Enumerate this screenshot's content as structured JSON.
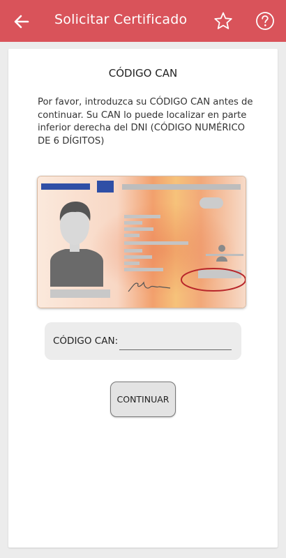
{
  "appbar": {
    "title": "Solicitar Certificado",
    "icons": [
      "arrow-left-icon",
      "star-icon",
      "help-icon"
    ]
  },
  "card": {
    "heading": "CÓDIGO CAN",
    "instructions": "Por favor, introduzca su CÓDIGO CAN antes de continuar. Su CAN lo puede localizar en parte inferior derecha del DNI (CÓDIGO NUMÉRICO DE 6 DÍGITOS)"
  },
  "form": {
    "can_label": "CÓDIGO CAN:",
    "can_value": ""
  },
  "actions": {
    "continue_label": "CONTINUAR"
  },
  "colors": {
    "appbar": "#d9535a",
    "card": "#ffffff",
    "background": "#ececec",
    "highlight_oval": "#b8262a"
  }
}
